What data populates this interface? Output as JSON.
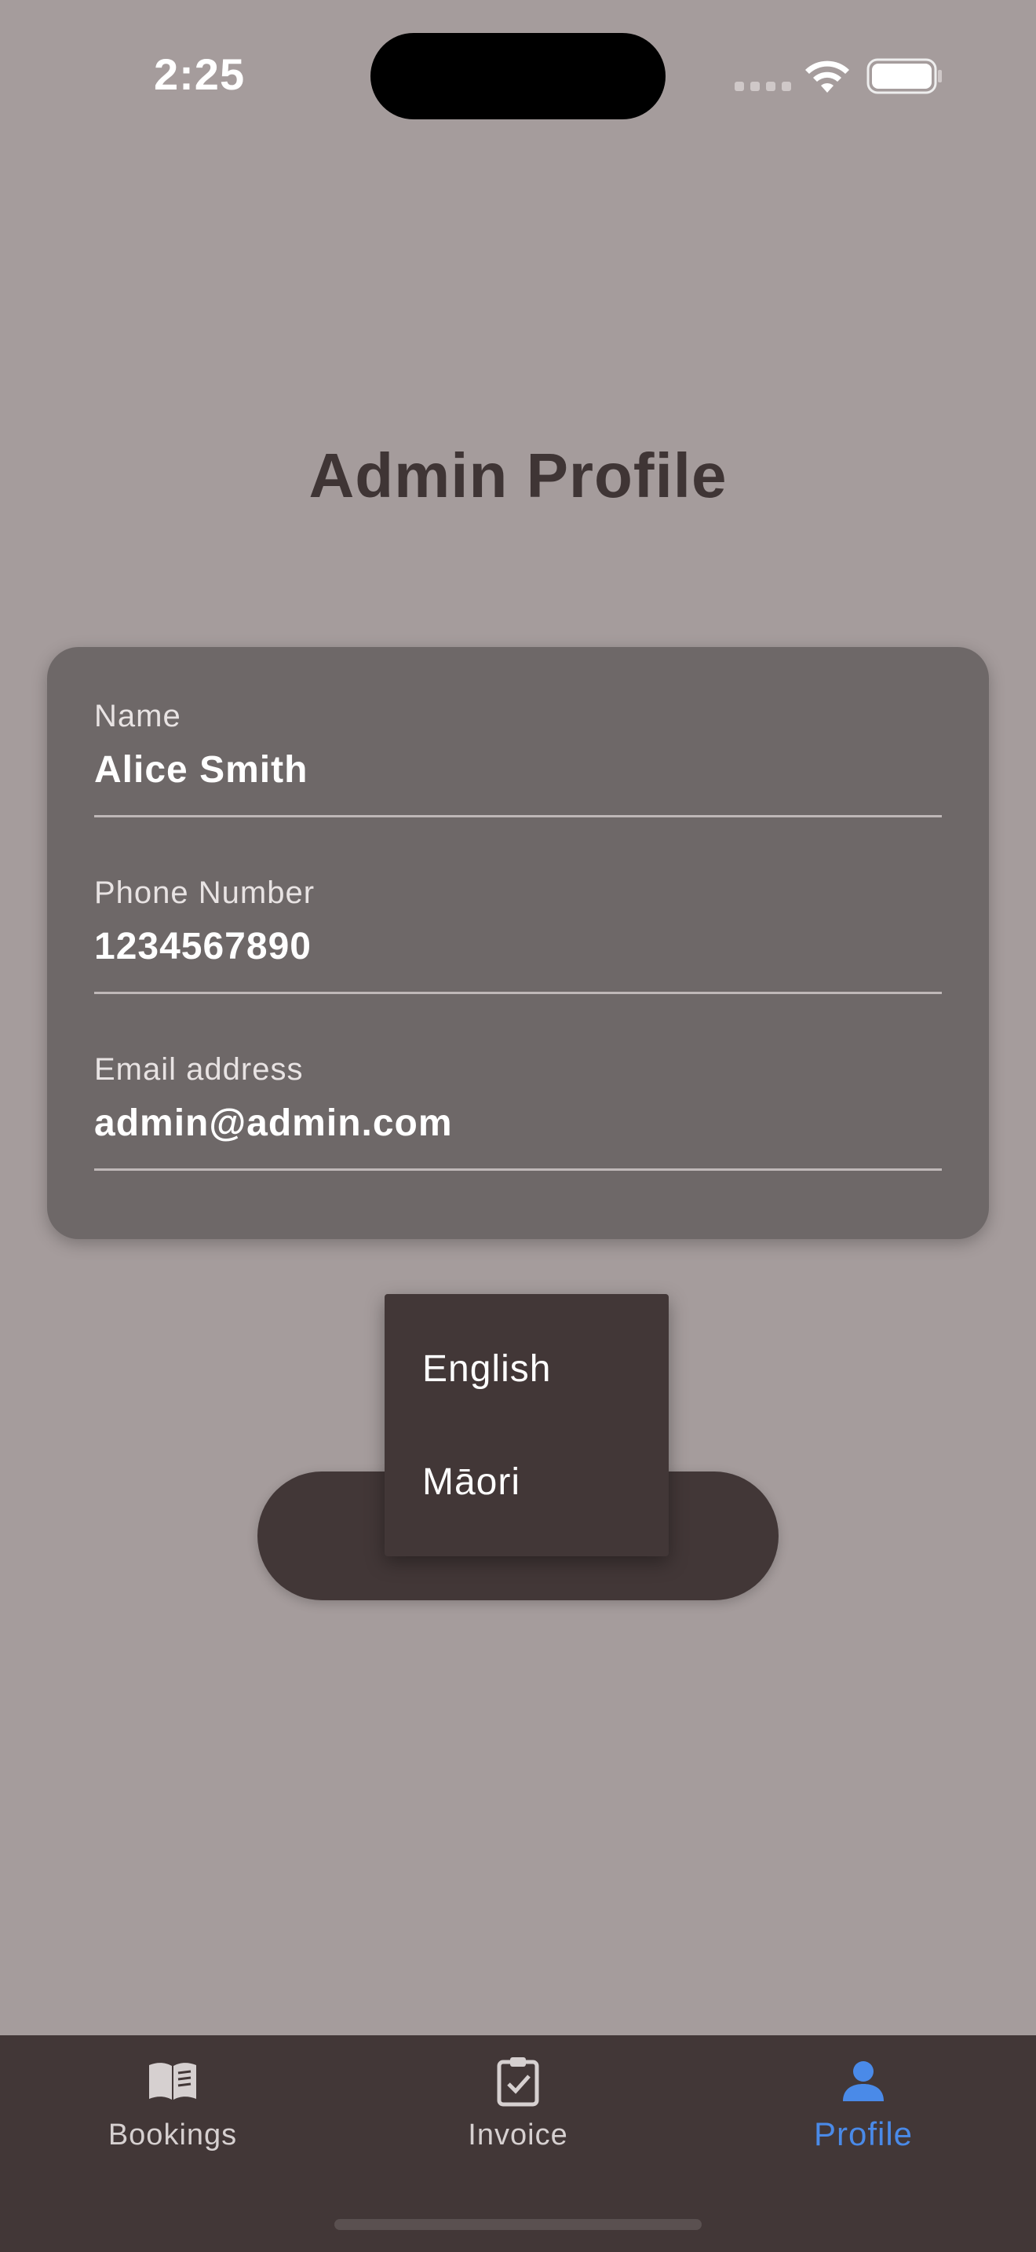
{
  "status_bar": {
    "time": "2:25"
  },
  "page": {
    "title": "Admin Profile"
  },
  "profile": {
    "fields": [
      {
        "label": "Name",
        "value": "Alice Smith"
      },
      {
        "label": "Phone Number",
        "value": "1234567890"
      },
      {
        "label": "Email address",
        "value": "admin@admin.com"
      }
    ]
  },
  "language_button": {
    "label": "English"
  },
  "language_menu": {
    "items": [
      "English",
      "Māori"
    ]
  },
  "bottom_nav": {
    "items": [
      {
        "label": "Bookings",
        "icon": "book-icon",
        "active": false
      },
      {
        "label": "Invoice",
        "icon": "clipboard-check-icon",
        "active": false
      },
      {
        "label": "Profile",
        "icon": "person-icon",
        "active": true
      }
    ],
    "active_color": "#4a8ae8"
  },
  "colors": {
    "background": "#a59c9c",
    "card": "#6e6868",
    "dark": "#423737"
  }
}
